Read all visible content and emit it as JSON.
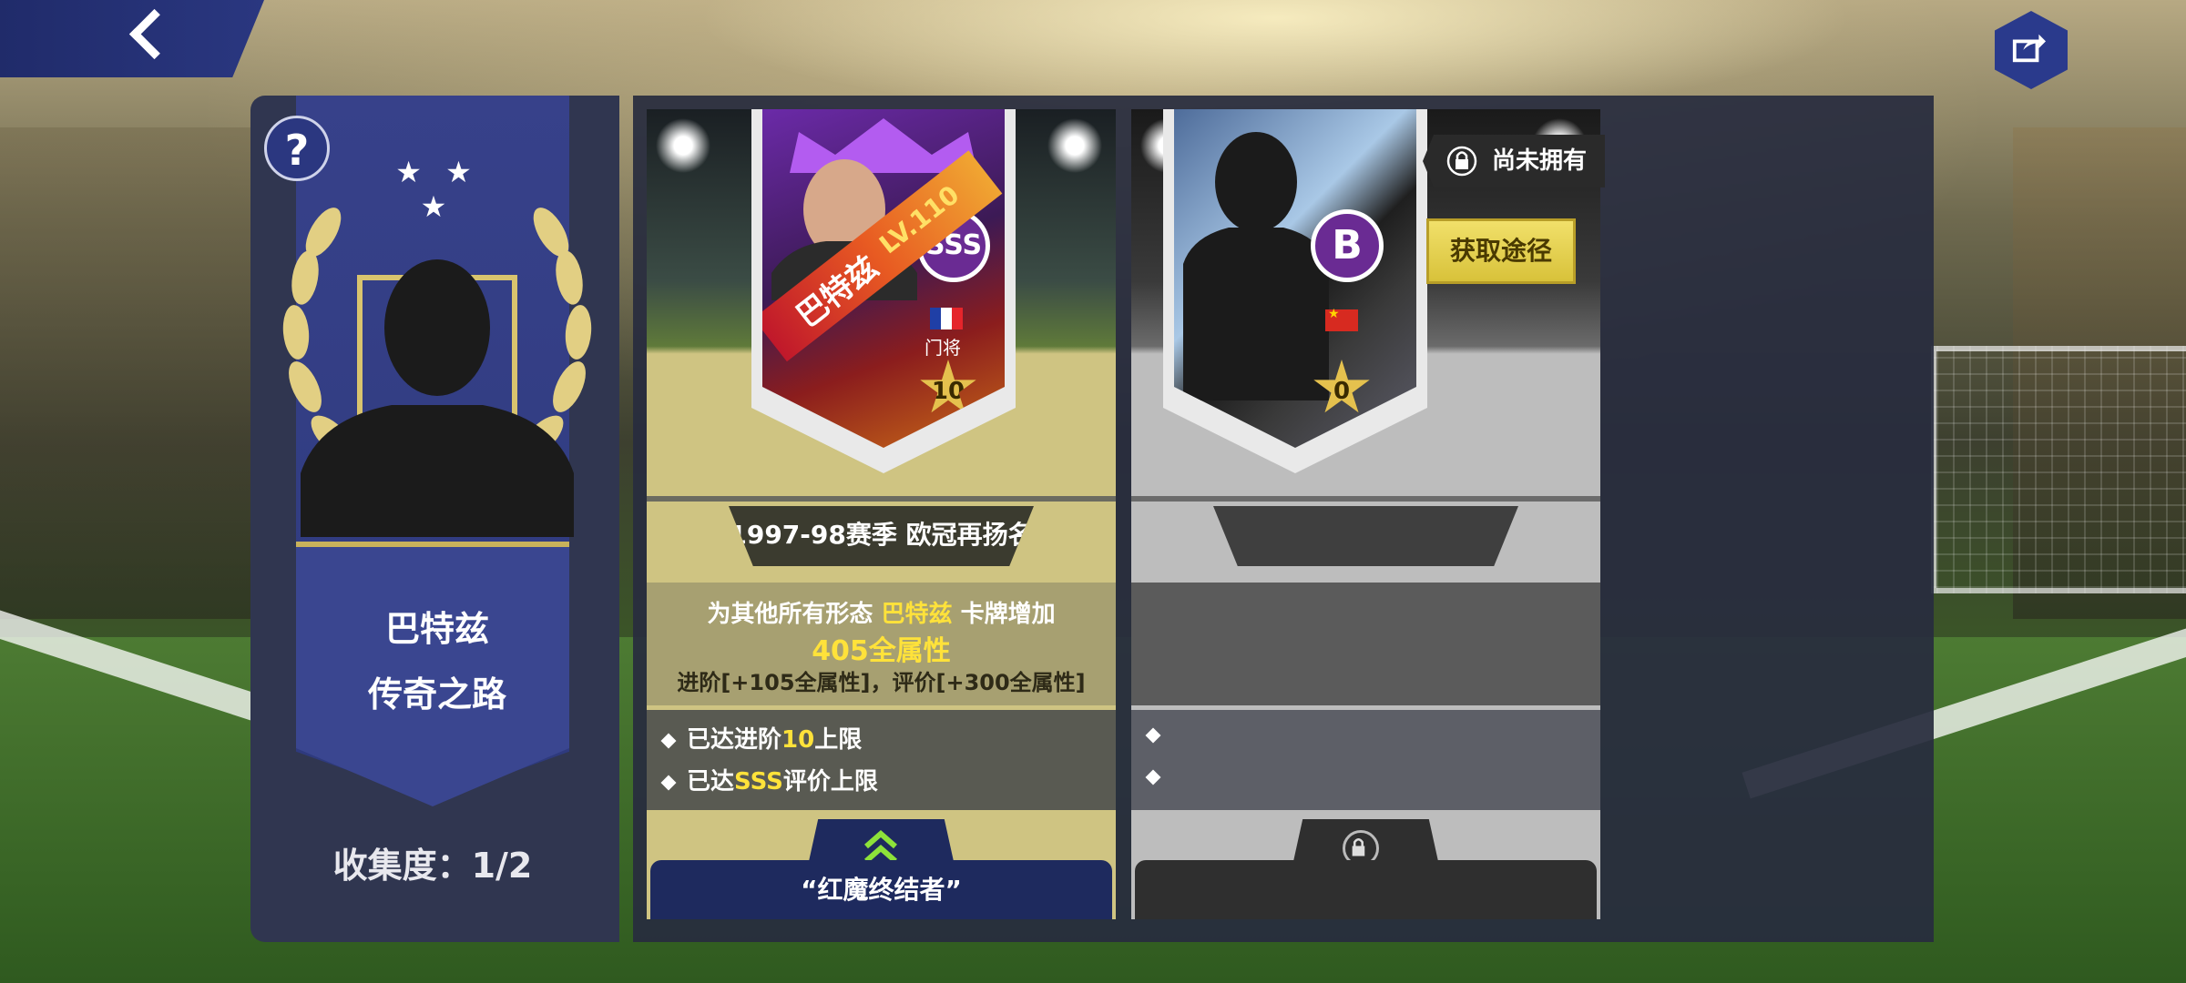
{
  "set": {
    "name_line1": "巴特兹",
    "name_line2": "传奇之路",
    "collection_text": "收集度：1/2",
    "stars": "★ ★ ★"
  },
  "buttons": {
    "help_label": "?"
  },
  "cards": [
    {
      "player_name": "巴特兹",
      "level": "LV.110",
      "rank": "SSS",
      "position": "门将",
      "star_level": "10",
      "series_tag": "传奇之路",
      "season_title": "1997-98赛季 欧冠再扬名",
      "desc_prefix": "为其他所有形态",
      "desc_name": "巴特兹",
      "desc_suffix": "卡牌增加",
      "desc_bonus": "405全属性",
      "desc_detail": "进阶[+105全属性]，评价[+300全属性]",
      "cond1_prefix": "已达进阶",
      "cond1_value": "10",
      "cond1_suffix": "上限",
      "cond2_prefix": "已达",
      "cond2_value": "SSS",
      "cond2_suffix": "评价上限",
      "skill_title": "“红魔终结者”"
    },
    {
      "rank": "B",
      "star_level": "0",
      "status_text": "尚未拥有",
      "get_button_label": "获取途径"
    }
  ]
}
